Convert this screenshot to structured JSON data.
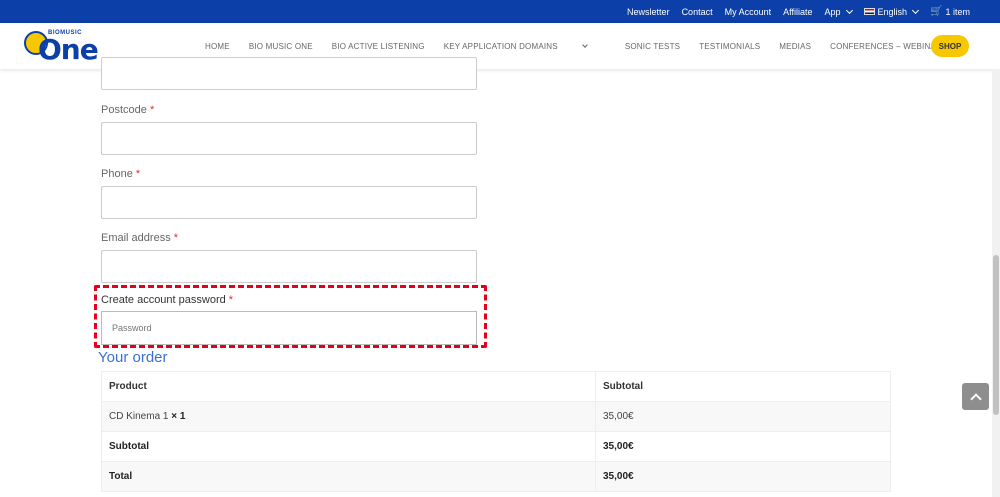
{
  "topbar": {
    "links": [
      "Newsletter",
      "Contact",
      "My Account",
      "Affiliate"
    ],
    "app_label": "App",
    "language": "English",
    "cart": "1 item"
  },
  "header": {
    "logo_small": "BIOMUSIC",
    "logo_main": "One",
    "nav": [
      "HOME",
      "BIO MUSIC ONE",
      "BIO ACTIVE LISTENING",
      "KEY APPLICATION DOMAINS",
      "SONIC TESTS",
      "TESTIMONIALS",
      "MEDIAS",
      "CONFERENCES – WEBINARS"
    ],
    "shop": "SHOP"
  },
  "form": {
    "postcode_label": "Postcode",
    "phone_label": "Phone",
    "email_label": "Email address",
    "required_mark": "*",
    "password_label": "Create account password",
    "password_placeholder": "Password"
  },
  "order": {
    "title": "Your order",
    "headers": [
      "Product",
      "Subtotal"
    ],
    "product_name": "CD Kinema 1",
    "product_qty": "× 1",
    "product_price": "35,00€",
    "subtotal_label": "Subtotal",
    "subtotal_value": "35,00€",
    "total_label": "Total",
    "total_value": "35,00€"
  },
  "colors": {
    "brand_blue": "#0c3fa8",
    "accent_yellow": "#f7c700",
    "highlight_red": "#e4001b",
    "title_blue": "#3b6fd8"
  }
}
